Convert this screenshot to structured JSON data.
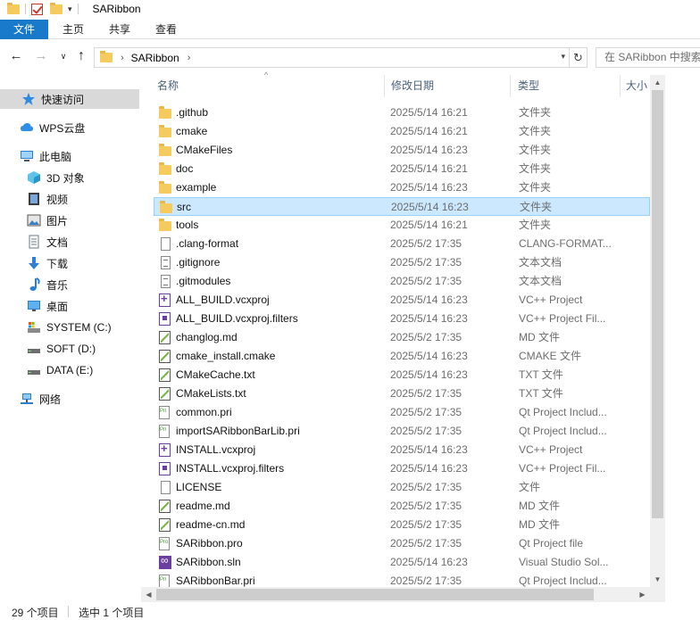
{
  "window": {
    "title": "SARibbon"
  },
  "ribbon": {
    "tabs": [
      {
        "label": "文件"
      },
      {
        "label": "主页"
      },
      {
        "label": "共享"
      },
      {
        "label": "查看"
      }
    ]
  },
  "addressbar": {
    "path": "SARibbon",
    "search_placeholder": "在 SARibbon 中搜索"
  },
  "navpane": {
    "items": [
      {
        "label": "快速访问",
        "icon": "star-icon"
      },
      {
        "label": "WPS云盘",
        "icon": "cloud-icon"
      },
      {
        "label": "此电脑",
        "icon": "computer-icon"
      },
      {
        "label": "3D 对象",
        "icon": "3d-objects-icon"
      },
      {
        "label": "视频",
        "icon": "video-icon"
      },
      {
        "label": "图片",
        "icon": "picture-icon"
      },
      {
        "label": "文档",
        "icon": "document-icon"
      },
      {
        "label": "下载",
        "icon": "download-icon"
      },
      {
        "label": "音乐",
        "icon": "music-icon"
      },
      {
        "label": "桌面",
        "icon": "desktop-icon"
      },
      {
        "label": "SYSTEM (C:)",
        "icon": "system-drive-icon"
      },
      {
        "label": "SOFT (D:)",
        "icon": "drive-icon"
      },
      {
        "label": "DATA (E:)",
        "icon": "drive-icon"
      },
      {
        "label": "网络",
        "icon": "network-icon"
      }
    ]
  },
  "columns": {
    "name": "名称",
    "date": "修改日期",
    "type": "类型",
    "size": "大小"
  },
  "files": [
    {
      "name": ".github",
      "date": "2025/5/14 16:21",
      "type": "文件夹",
      "icon": "folder-icon"
    },
    {
      "name": "cmake",
      "date": "2025/5/14 16:21",
      "type": "文件夹",
      "icon": "folder-icon"
    },
    {
      "name": "CMakeFiles",
      "date": "2025/5/14 16:23",
      "type": "文件夹",
      "icon": "folder-icon"
    },
    {
      "name": "doc",
      "date": "2025/5/14 16:21",
      "type": "文件夹",
      "icon": "folder-icon"
    },
    {
      "name": "example",
      "date": "2025/5/14 16:23",
      "type": "文件夹",
      "icon": "folder-icon"
    },
    {
      "name": "src",
      "date": "2025/5/14 16:23",
      "type": "文件夹",
      "icon": "folder-icon",
      "selected": true
    },
    {
      "name": "tools",
      "date": "2025/5/14 16:21",
      "type": "文件夹",
      "icon": "folder-icon"
    },
    {
      "name": ".clang-format",
      "date": "2025/5/2 17:35",
      "type": "CLANG-FORMAT...",
      "icon": "file-icon"
    },
    {
      "name": ".gitignore",
      "date": "2025/5/2 17:35",
      "type": "文本文档",
      "icon": "text-file-icon"
    },
    {
      "name": ".gitmodules",
      "date": "2025/5/2 17:35",
      "type": "文本文档",
      "icon": "text-file-icon"
    },
    {
      "name": "ALL_BUILD.vcxproj",
      "date": "2025/5/14 16:23",
      "type": "VC++ Project",
      "icon": "vcxproj-icon"
    },
    {
      "name": "ALL_BUILD.vcxproj.filters",
      "date": "2025/5/14 16:23",
      "type": "VC++ Project Fil...",
      "icon": "vcxproj-filters-icon"
    },
    {
      "name": "changlog.md",
      "date": "2025/5/2 17:35",
      "type": "MD 文件",
      "icon": "markdown-icon"
    },
    {
      "name": "cmake_install.cmake",
      "date": "2025/5/14 16:23",
      "type": "CMAKE 文件",
      "icon": "markdown-icon"
    },
    {
      "name": "CMakeCache.txt",
      "date": "2025/5/14 16:23",
      "type": "TXT 文件",
      "icon": "markdown-icon"
    },
    {
      "name": "CMakeLists.txt",
      "date": "2025/5/2 17:35",
      "type": "TXT 文件",
      "icon": "markdown-icon"
    },
    {
      "name": "common.pri",
      "date": "2025/5/2 17:35",
      "type": "Qt Project Includ...",
      "icon": "pri-icon"
    },
    {
      "name": "importSARibbonBarLib.pri",
      "date": "2025/5/2 17:35",
      "type": "Qt Project Includ...",
      "icon": "pri-icon"
    },
    {
      "name": "INSTALL.vcxproj",
      "date": "2025/5/14 16:23",
      "type": "VC++ Project",
      "icon": "vcxproj-icon"
    },
    {
      "name": "INSTALL.vcxproj.filters",
      "date": "2025/5/14 16:23",
      "type": "VC++ Project Fil...",
      "icon": "vcxproj-filters-icon"
    },
    {
      "name": "LICENSE",
      "date": "2025/5/2 17:35",
      "type": "文件",
      "icon": "file-icon"
    },
    {
      "name": "readme.md",
      "date": "2025/5/2 17:35",
      "type": "MD 文件",
      "icon": "markdown-icon"
    },
    {
      "name": "readme-cn.md",
      "date": "2025/5/2 17:35",
      "type": "MD 文件",
      "icon": "markdown-icon"
    },
    {
      "name": "SARibbon.pro",
      "date": "2025/5/2 17:35",
      "type": "Qt Project file",
      "icon": "pro-icon"
    },
    {
      "name": "SARibbon.sln",
      "date": "2025/5/14 16:23",
      "type": "Visual Studio Sol...",
      "icon": "sln-icon"
    },
    {
      "name": "SARibbonBar.pri",
      "date": "2025/5/2 17:35",
      "type": "Qt Project Includ...",
      "icon": "pri-icon"
    }
  ],
  "status": {
    "count": "29 个项目",
    "selection": "选中 1 个项目"
  }
}
